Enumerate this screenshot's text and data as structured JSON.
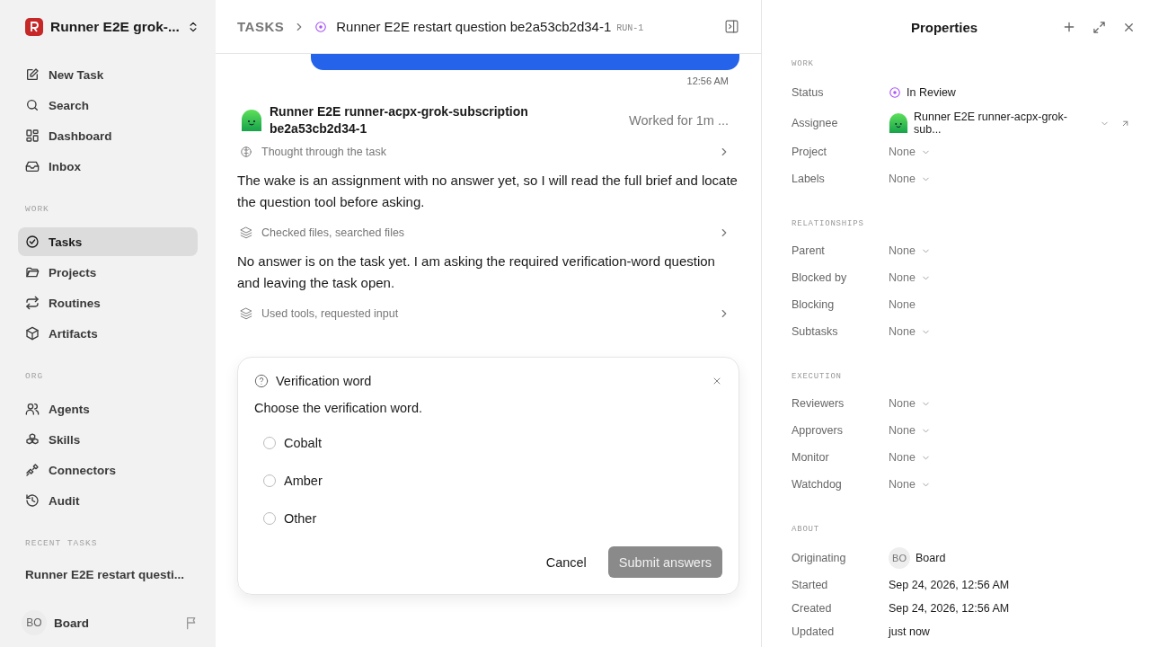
{
  "workspace": {
    "name": "Runner E2E grok-..."
  },
  "sidebar": {
    "items": [
      {
        "label": "New Task",
        "selected": false
      },
      {
        "label": "Search",
        "selected": false
      },
      {
        "label": "Dashboard",
        "selected": false
      },
      {
        "label": "Inbox",
        "selected": false
      }
    ],
    "sections": [
      {
        "title": "WORK",
        "items": [
          {
            "label": "Tasks",
            "selected": true
          },
          {
            "label": "Projects",
            "selected": false
          },
          {
            "label": "Routines",
            "selected": false
          },
          {
            "label": "Artifacts",
            "selected": false
          }
        ]
      },
      {
        "title": "ORG",
        "items": [
          {
            "label": "Agents",
            "selected": false
          },
          {
            "label": "Skills",
            "selected": false
          },
          {
            "label": "Connectors",
            "selected": false
          },
          {
            "label": "Audit",
            "selected": false
          }
        ]
      }
    ],
    "recent": {
      "title": "RECENT TASKS",
      "items": [
        {
          "label": "Runner E2E restart questi...",
          "selected": false
        }
      ]
    },
    "user": {
      "initials": "BO",
      "name": "Board"
    }
  },
  "header": {
    "breadcrumb": "TASKS",
    "title": "Runner E2E restart question be2a53cb2d34-1",
    "run": "RUN-1"
  },
  "thread": {
    "message_time": "12:56 AM",
    "agent": {
      "name": "Runner E2E runner-acpx-grok-subscription be2a53cb2d34-1",
      "duration": "Worked for 1m ..."
    },
    "entries": [
      {
        "kind": "thinking",
        "text": "Thought through the task"
      },
      {
        "kind": "paragraph",
        "text": "The wake is an assignment with no answer yet, so I will read the full brief and locate the question tool before asking."
      },
      {
        "kind": "actions",
        "text": "Checked files, searched files"
      },
      {
        "kind": "paragraph",
        "text": "No answer is on the task yet. I am asking the required verification-word question and leaving the task open."
      },
      {
        "kind": "actions",
        "text": "Used tools, requested input"
      }
    ]
  },
  "question": {
    "title": "Verification word",
    "prompt": "Choose the verification word.",
    "options": [
      {
        "label": "Cobalt",
        "selected": false
      },
      {
        "label": "Amber",
        "selected": false
      },
      {
        "label": "Other",
        "selected": false
      }
    ],
    "buttons": [
      {
        "label": "Cancel",
        "kind": "secondary",
        "disabled": false
      },
      {
        "label": "Submit answers",
        "kind": "primary",
        "disabled": true
      }
    ]
  },
  "properties": {
    "title": "Properties",
    "sections": [
      {
        "title": "WORK",
        "rows": [
          {
            "label": "Status",
            "kind": "status",
            "value": "In Review"
          },
          {
            "label": "Assignee",
            "kind": "agent",
            "value": "Runner E2E runner-acpx-grok-sub..."
          },
          {
            "label": "Project",
            "kind": "dropdown",
            "value": "None"
          },
          {
            "label": "Labels",
            "kind": "dropdown",
            "value": "None"
          }
        ]
      },
      {
        "title": "RELATIONSHIPS",
        "rows": [
          {
            "label": "Parent",
            "kind": "dropdown",
            "value": "None"
          },
          {
            "label": "Blocked by",
            "kind": "dropdown",
            "value": "None"
          },
          {
            "label": "Blocking",
            "kind": "empty",
            "value": "None"
          },
          {
            "label": "Subtasks",
            "kind": "dropdown",
            "value": "None"
          }
        ]
      },
      {
        "title": "EXECUTION",
        "rows": [
          {
            "label": "Reviewers",
            "kind": "dropdown",
            "value": "None"
          },
          {
            "label": "Approvers",
            "kind": "dropdown",
            "value": "None"
          },
          {
            "label": "Monitor",
            "kind": "dropdown",
            "value": "None"
          },
          {
            "label": "Watchdog",
            "kind": "dropdown",
            "value": "None"
          }
        ]
      },
      {
        "title": "ABOUT",
        "rows": [
          {
            "label": "Originating",
            "kind": "person",
            "initials": "BO",
            "value": "Board"
          },
          {
            "label": "Started",
            "kind": "date",
            "value": "Sep 24, 2026, 12:56 AM"
          },
          {
            "label": "Created",
            "kind": "date",
            "value": "Sep 24, 2026, 12:56 AM"
          },
          {
            "label": "Updated",
            "kind": "date",
            "value": "just now"
          }
        ]
      }
    ]
  }
}
